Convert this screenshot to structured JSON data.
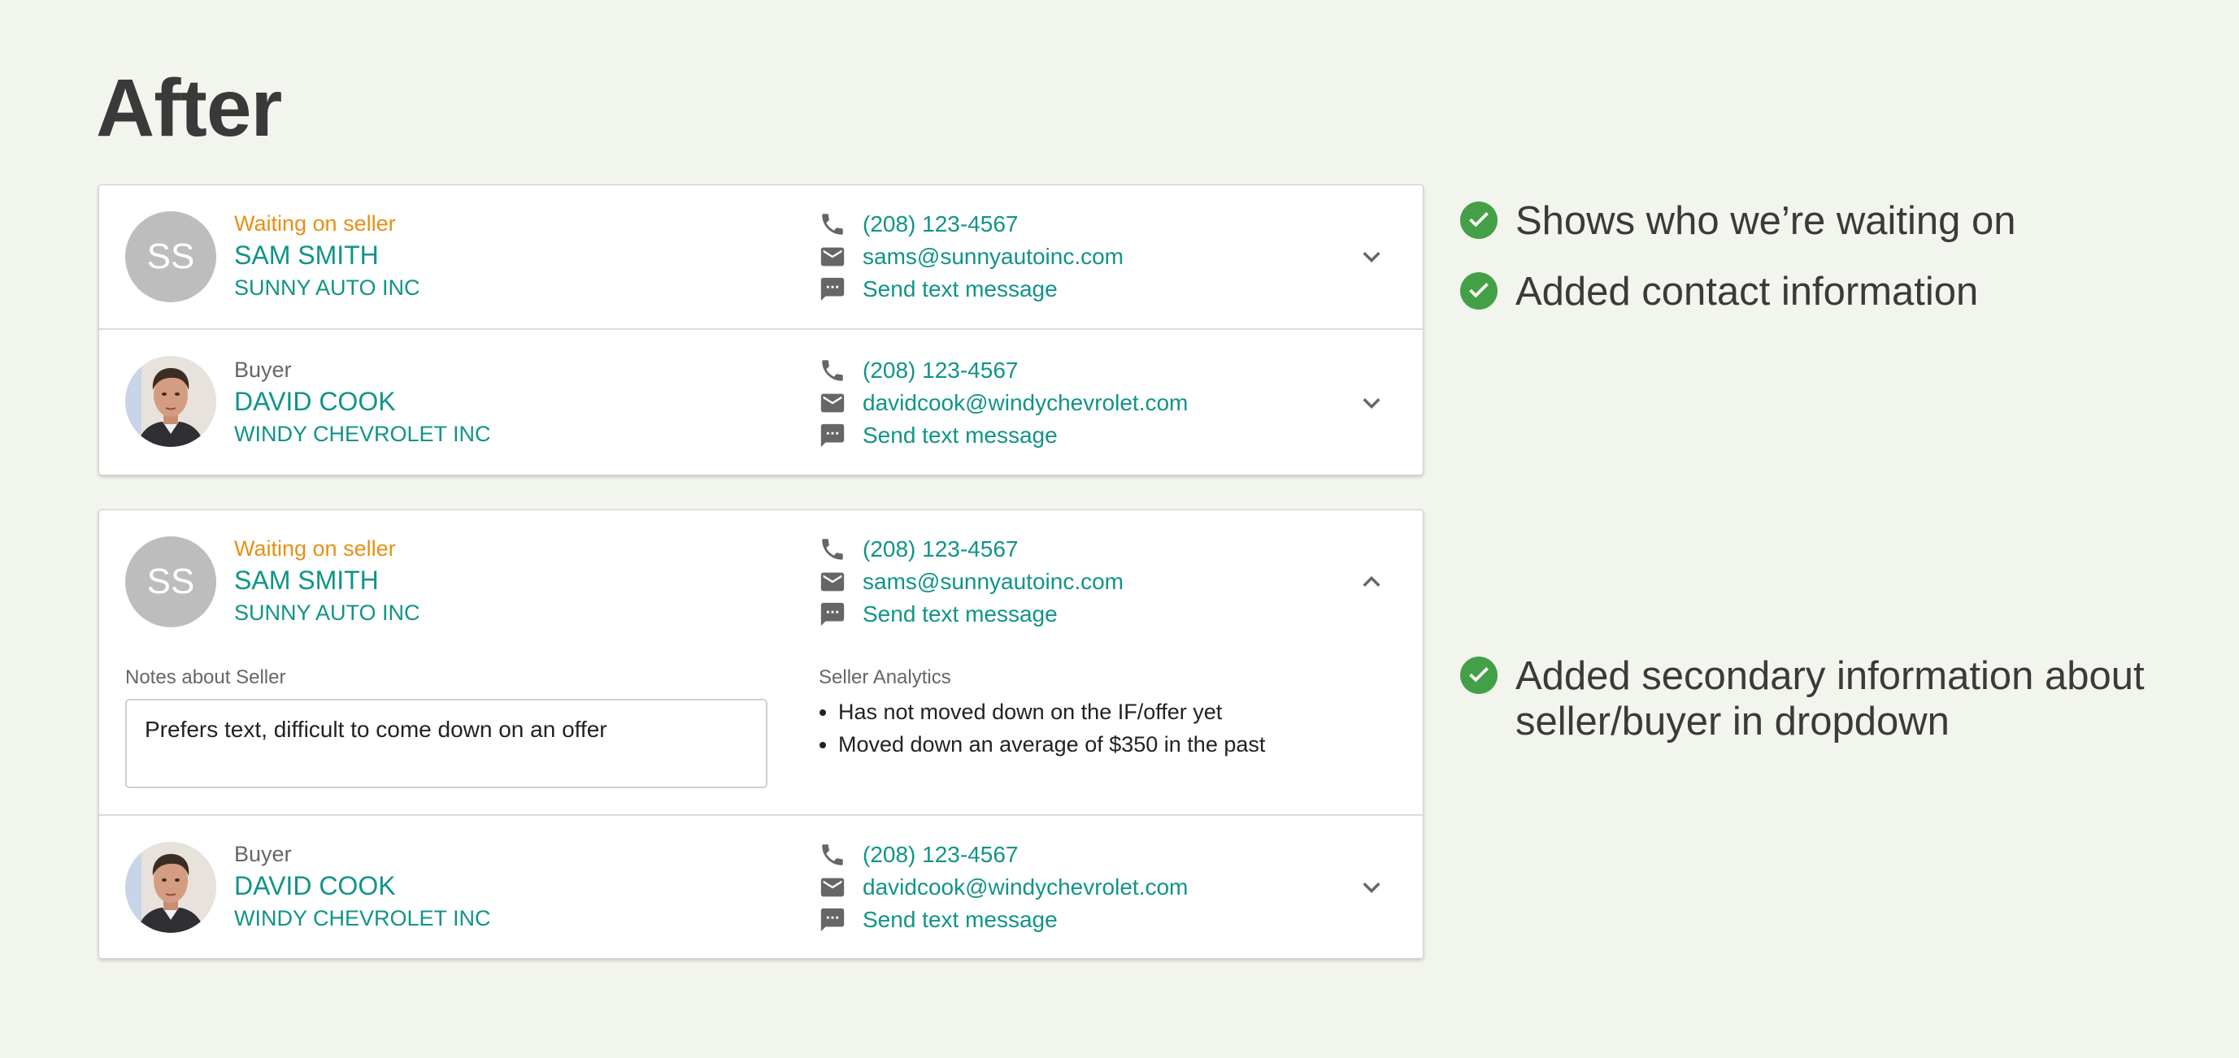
{
  "page": {
    "title": "After"
  },
  "colors": {
    "accent": "#109488",
    "status": "#e88f14",
    "check": "#43a047",
    "background": "#f2f4ee"
  },
  "card1": {
    "seller": {
      "status": "Waiting on seller",
      "initials": "SS",
      "name": "SAM SMITH",
      "company": "SUNNY AUTO INC",
      "phone": "(208) 123-4567",
      "email": "sams@sunnyautoinc.com",
      "text": "Send text message",
      "chevron": "chevron-down-icon"
    },
    "buyer": {
      "role": "Buyer",
      "name": "DAVID COOK",
      "company": "WINDY CHEVROLET INC",
      "phone": "(208) 123-4567",
      "email": "davidcook@windychevrolet.com",
      "text": "Send text message",
      "chevron": "chevron-down-icon"
    }
  },
  "card2": {
    "seller": {
      "status": "Waiting on seller",
      "initials": "SS",
      "name": "SAM SMITH",
      "company": "SUNNY AUTO INC",
      "phone": "(208) 123-4567",
      "email": "sams@sunnyautoinc.com",
      "text": "Send text message",
      "chevron": "chevron-up-icon",
      "notes_label": "Notes about Seller",
      "notes_value": "Prefers text, difficult to come down on an offer",
      "analytics_label": "Seller Analytics",
      "analytics": [
        "Has not moved down on the IF/offer yet",
        "Moved down an average of $350 in the past"
      ]
    },
    "buyer": {
      "role": "Buyer",
      "name": "DAVID COOK",
      "company": "WINDY CHEVROLET INC",
      "phone": "(208) 123-4567",
      "email": "davidcook@windychevrolet.com",
      "text": "Send text message",
      "chevron": "chevron-down-icon"
    }
  },
  "annotations": [
    "Shows who we’re waiting on",
    "Added contact information",
    "Added secondary information about seller/buyer in dropdown"
  ]
}
